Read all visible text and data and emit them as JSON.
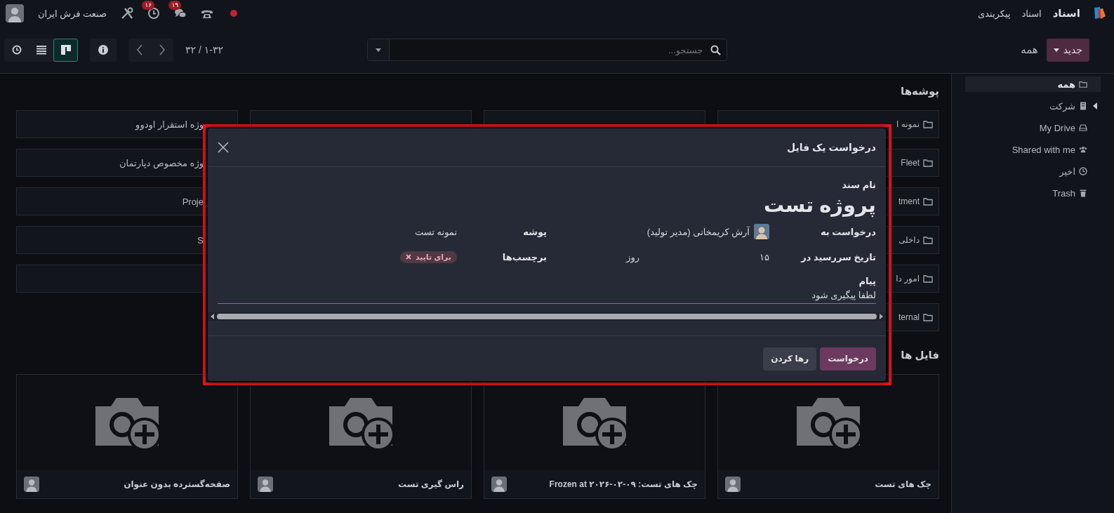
{
  "topbar": {
    "app_name": "اسناد",
    "menu": [
      "اسناد",
      "پیکربندی"
    ],
    "systray": [
      {
        "kind": "dot"
      },
      {
        "kind": "phone"
      },
      {
        "kind": "chat",
        "count": "۱۹"
      },
      {
        "kind": "activity",
        "count": "۱۶"
      },
      {
        "kind": "tools"
      }
    ],
    "company": "صنعت فرش ایران"
  },
  "controlbar": {
    "new_button": "جدید",
    "breadcrumb": "همه",
    "search": {
      "placeholder": "جستجو..."
    },
    "pager": "۱-۳۲ / ۳۲",
    "views": [
      {
        "kind": "kanban",
        "selected": true
      },
      {
        "kind": "list",
        "selected": false
      },
      {
        "kind": "activity",
        "selected": false
      }
    ]
  },
  "sidebar": {
    "items": [
      {
        "kind": "folder",
        "label": "همه",
        "selected": true
      },
      {
        "kind": "company",
        "label": "شرکت",
        "selected": false,
        "expanded": false
      },
      {
        "kind": "drive",
        "label": "My Drive",
        "selected": false
      },
      {
        "kind": "shared",
        "label": "Shared with me",
        "selected": false
      },
      {
        "kind": "recent",
        "label": "اخیر",
        "selected": false
      },
      {
        "kind": "trash",
        "label": "Trash",
        "selected": false
      }
    ]
  },
  "folders": {
    "title": "پوشه‌ها",
    "columns": [
      {
        "items": [
          {
            "kind": "folder",
            "label": "نمونه ا"
          },
          {
            "kind": "folder",
            "label": "Fleet"
          },
          {
            "kind": "folder",
            "label": "tment"
          },
          {
            "kind": "folder",
            "label": "داخلی"
          },
          {
            "kind": "folder",
            "label": "امور دا"
          },
          {
            "kind": "folder",
            "label": "ternal"
          }
        ]
      },
      {
        "items": [
          {
            "kind": "blank"
          }
        ]
      },
      {
        "items": [
          {
            "kind": "blank"
          }
        ]
      },
      {
        "items": [
          {
            "kind": "folder",
            "label": "وژه استقرار اودوو"
          },
          {
            "kind": "folder",
            "label": "وژه مخصوص دپارتمان"
          },
          {
            "kind": "folder",
            "label": "Proje"
          },
          {
            "kind": "folder",
            "label": "S"
          },
          {
            "kind": "blank"
          }
        ]
      }
    ]
  },
  "files": {
    "title": "فایل ها",
    "items": [
      {
        "name": "چک های تست"
      },
      {
        "name": "چک های تست: Frozen at ۲۰۲۶-۰۲-۰۹"
      },
      {
        "name": "راس گیری تست"
      },
      {
        "name": "صفحه‌گسترده بدون عنوان"
      }
    ]
  },
  "dialog": {
    "highlighted": true,
    "title": "درخواست یک فایل",
    "name_label": "نام سند",
    "name": "پروژه تست",
    "fields": [
      {
        "kind": "user",
        "label": "درخواست به",
        "value": "آرش کریمخانی (مدیر تولید)"
      },
      {
        "kind": "text",
        "label": "پوشه",
        "value": "نمونه تست"
      },
      {
        "kind": "days",
        "label": "تاریخ سررسید در",
        "value": "۱۵",
        "unit": "روز"
      },
      {
        "kind": "tags",
        "label": "برچسب‌ها",
        "tags": [
          "برای تایید"
        ]
      }
    ],
    "message_label": "پیام",
    "message": "لطفا پیگیری شود",
    "buttons": [
      {
        "kind": "primary",
        "label": "درخواست"
      },
      {
        "kind": "secondary",
        "label": "رها کردن"
      }
    ]
  }
}
